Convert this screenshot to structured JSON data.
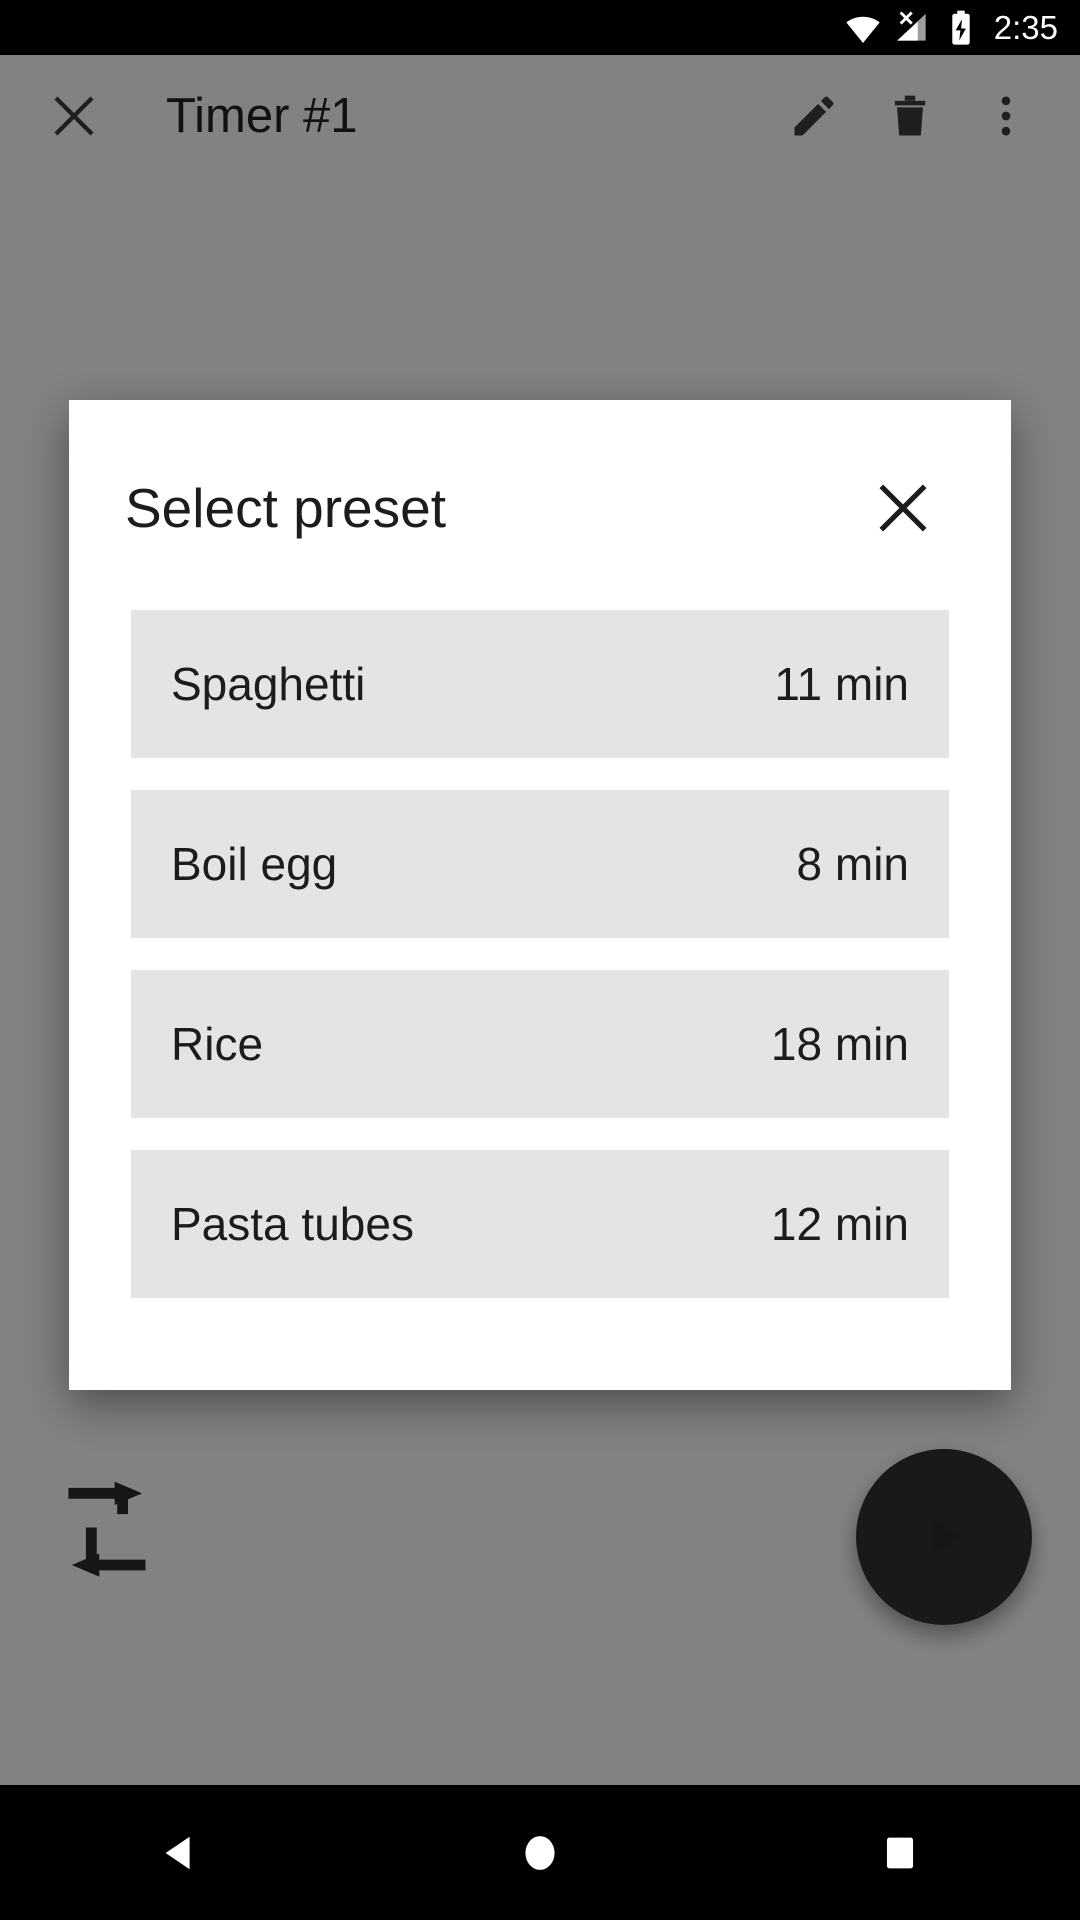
{
  "status_bar": {
    "time": "2:35",
    "icons": [
      {
        "name": "wifi-icon",
        "label": "wifi"
      },
      {
        "name": "cellular-no-sim-icon",
        "label": "cellular-signal-off"
      },
      {
        "name": "battery-charging-icon",
        "label": "battery-charging"
      }
    ]
  },
  "app": {
    "title": "Timer #1",
    "actions": {
      "close_label": "close",
      "edit_label": "edit",
      "delete_label": "delete",
      "overflow_label": "more options"
    },
    "loop_label": "loop",
    "play_label": "play"
  },
  "dialog": {
    "title": "Select preset",
    "close_label": "close",
    "presets": [
      {
        "name": "Spaghetti",
        "duration": "11 min"
      },
      {
        "name": "Boil egg",
        "duration": "8 min"
      },
      {
        "name": "Rice",
        "duration": "18 min"
      },
      {
        "name": "Pasta tubes",
        "duration": "12 min"
      }
    ]
  },
  "nav_bar": {
    "back_label": "back",
    "home_label": "home",
    "recents_label": "recent apps"
  },
  "colors": {
    "dialog_background": "#ffffff",
    "row_background": "#e4e4e4",
    "scrim": "rgba(0,0,0,0.48)",
    "text_primary": "#1c1c1c",
    "status_bar": "#000000",
    "nav_bar": "#000000",
    "fab": "#303030"
  }
}
